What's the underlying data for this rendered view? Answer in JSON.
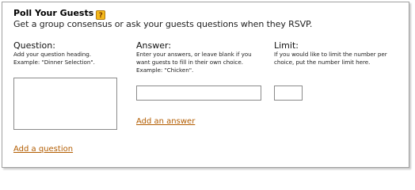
{
  "header": {
    "title": "Poll Your Guests",
    "help_icon_glyph": "?",
    "subtitle": "Get a group consensus or ask your guests questions when they RSVP."
  },
  "columns": {
    "question": {
      "heading": "Question:",
      "description_lines": [
        "Add your question heading.",
        "Example: \"Dinner Selection\"."
      ],
      "value": ""
    },
    "answer": {
      "heading": "Answer:",
      "description_lines": [
        "Enter your answers, or leave blank if you",
        "want guests to fill in their own choice.",
        "Example: \"Chicken\"."
      ],
      "value": ""
    },
    "limit": {
      "heading": "Limit:",
      "description_lines": [
        "If you would like to limit the number per",
        "choice, put the number limit here."
      ],
      "value": ""
    }
  },
  "actions": {
    "add_answer": "Add an answer",
    "add_question": "Add a question"
  },
  "colors": {
    "link": "#b25c00",
    "help_icon": "#f5b91b",
    "border": "#a0a0a0"
  }
}
